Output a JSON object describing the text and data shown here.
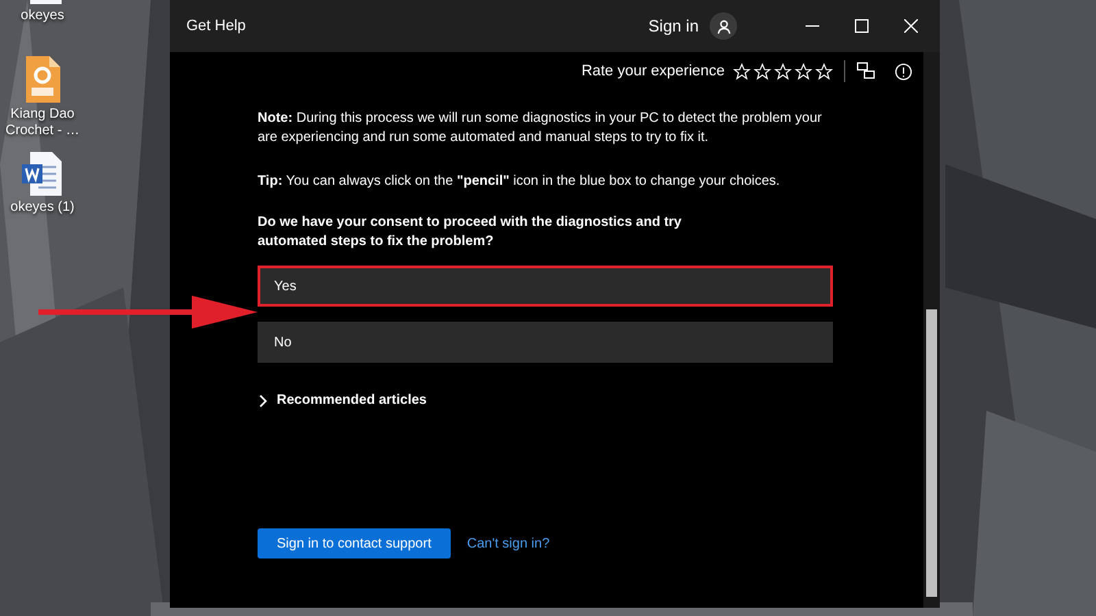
{
  "desktop_icons": [
    {
      "kind": "word",
      "label": "okeyes"
    },
    {
      "kind": "pdf",
      "label": "Kiang Dao Crochet - …"
    },
    {
      "kind": "word",
      "label": "okeyes (1)"
    }
  ],
  "window": {
    "title": "Get Help",
    "sign_in": "Sign in"
  },
  "toolbar": {
    "rate_label": "Rate your experience",
    "stars": 0
  },
  "content": {
    "note": "**Note:** During this process we will run some diagnostics in your PC to detect the problem your are experiencing and run some automated  and manual steps to try to fix it.",
    "tip": "**Tip:** You can always click on the **\"pencil\"** icon in the blue box to change your choices.",
    "question": "Do we have your consent to proceed with the diagnostics and try automated steps to fix the problem?",
    "options": [
      {
        "label": "Yes",
        "highlighted": true
      },
      {
        "label": "No",
        "highlighted": false
      }
    ],
    "recommended": {
      "label": "Recommended articles",
      "expanded": false
    },
    "primary_button": "Sign in to contact support",
    "link": "Can't sign in?"
  },
  "annotations": [
    {
      "kind": "arrow"
    }
  ]
}
